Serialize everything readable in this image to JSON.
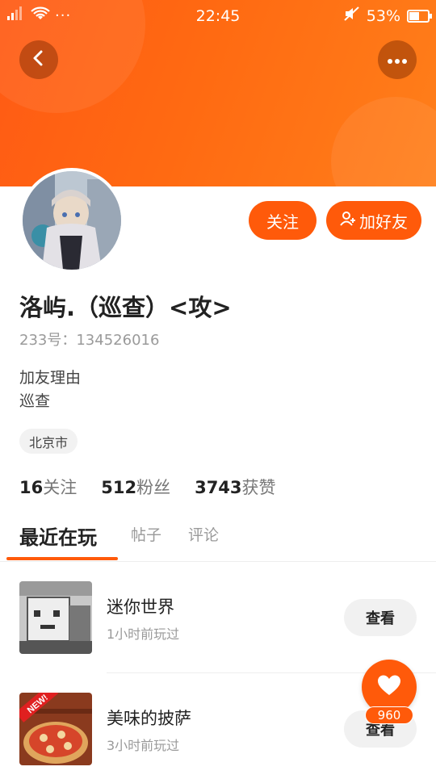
{
  "status_bar": {
    "signal": "ᴵll",
    "dots": "···",
    "time": "22:45",
    "battery_percent": "53%",
    "battery_level": 0.53
  },
  "header": {
    "back_icon": "chevron-left-icon",
    "more_icon": "more-dots-icon"
  },
  "profile": {
    "follow_label": "关注",
    "add_friend_label": "加好友",
    "username": "洛屿.（巡查）<攻>",
    "user_id": "233号：134526016",
    "reason_label": "加友理由",
    "reason_text": "巡查",
    "city": "北京市"
  },
  "stats": [
    {
      "value": "16",
      "label": "关注"
    },
    {
      "value": "512",
      "label": "粉丝"
    },
    {
      "value": "3743",
      "label": "获赞"
    }
  ],
  "tabs": [
    {
      "label": "最近在玩",
      "active": true
    },
    {
      "label": "帖子",
      "active": false
    },
    {
      "label": "评论",
      "active": false
    }
  ],
  "games": [
    {
      "title": "迷你世界",
      "time": "1小时前玩过",
      "button": "查看"
    },
    {
      "title": "美味的披萨",
      "time": "3小时前玩过",
      "button": "查看",
      "badge": "NEW!"
    }
  ],
  "like_fab": {
    "count": "960",
    "icon": "heart-icon"
  },
  "colors": {
    "accent": "#ff5a0a",
    "header_start": "#ff5a14",
    "header_end": "#ff7f1a"
  }
}
